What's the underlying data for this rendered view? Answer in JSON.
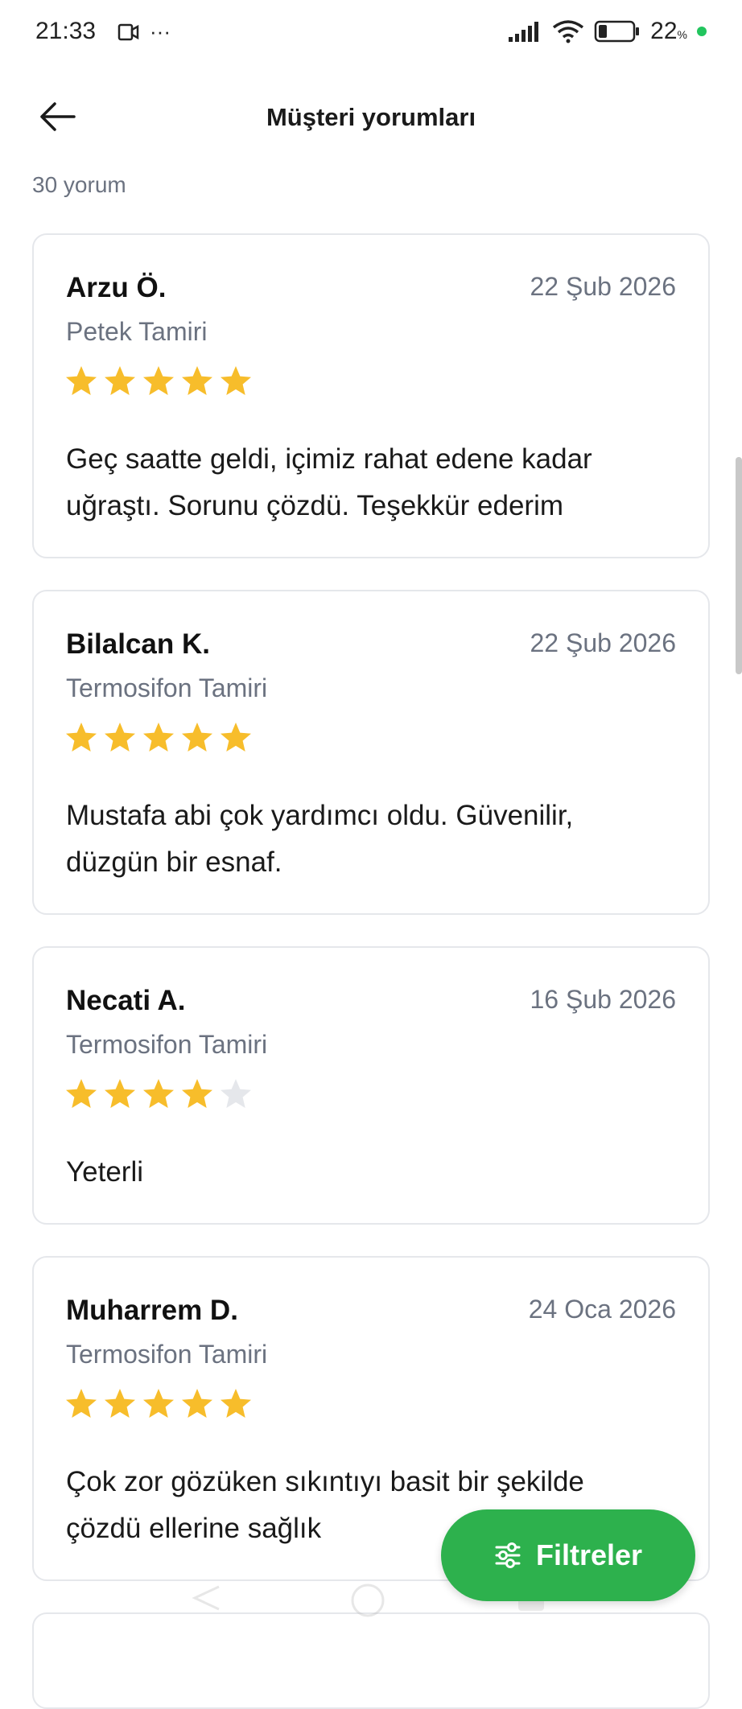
{
  "status_bar": {
    "time": "21:33",
    "more": "···",
    "battery_percent": "22",
    "battery_unit": "%",
    "icons": [
      "video-record-icon",
      "signal-icon",
      "wifi-icon",
      "battery-icon",
      "green-dot-icon"
    ]
  },
  "header": {
    "title": "Müşteri yorumları",
    "back_icon": "arrow-left-icon"
  },
  "review_count": "30 yorum",
  "colors": {
    "star_filled": "#f7bd2b",
    "star_empty": "#e5e7eb",
    "accent_green": "#2db14d",
    "muted_text": "#6b7280"
  },
  "reviews": [
    {
      "name": "Arzu Ö.",
      "date": "22 Şub 2026",
      "service": "Petek Tamiri",
      "rating": 5,
      "comment_line1": "Geç saatte geldi, içimiz rahat edene kadar",
      "comment_line2": "uğraştı. Sorunu çözdü. Teşekkür ederim"
    },
    {
      "name": "Bilalcan K.",
      "date": "22 Şub 2026",
      "service": "Termosifon Tamiri",
      "rating": 5,
      "comment_line1": "Mustafa abi çok yardımcı oldu. Güvenilir,",
      "comment_line2": "düzgün bir esnaf."
    },
    {
      "name": "Necati A.",
      "date": "16 Şub 2026",
      "service": "Termosifon Tamiri",
      "rating": 4,
      "comment_line1": "Yeterli",
      "comment_line2": ""
    },
    {
      "name": "Muharrem D.",
      "date": "24 Oca 2026",
      "service": "Termosifon Tamiri",
      "rating": 5,
      "comment_line1": "Çok zor gözüken sıkıntıyı basit bir şekilde",
      "comment_line2": "çözdü ellerine sağlık"
    }
  ],
  "fab": {
    "label": "Filtreler",
    "icon": "filter-sliders-icon"
  }
}
